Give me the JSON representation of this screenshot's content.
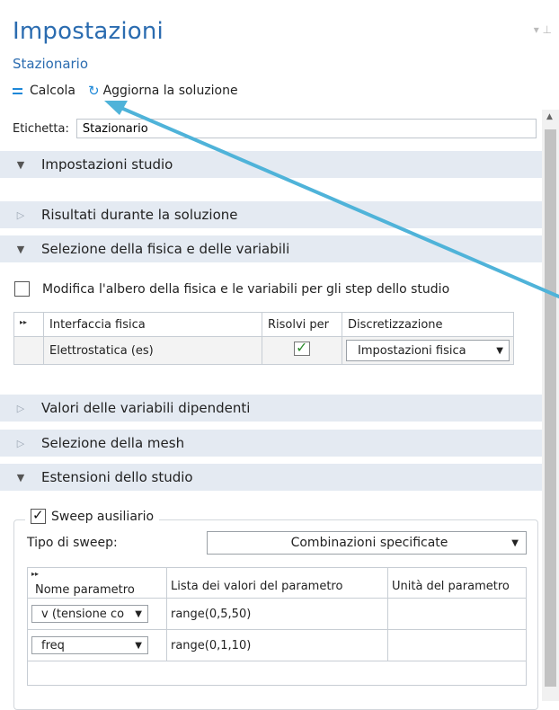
{
  "panel": {
    "title": "Impostazioni",
    "subtitle": "Stazionario"
  },
  "toolbar": {
    "compute_label": "Calcola",
    "update_label": "Aggiorna la soluzione"
  },
  "label_field": {
    "label": "Etichetta:",
    "value": "Stazionario"
  },
  "sections": {
    "study_settings": "Impostazioni studio",
    "results_while_solving": "Risultati durante la soluzione",
    "physics_selection": "Selezione della fisica e delle variabili",
    "dependent_values": "Valori delle variabili dipendenti",
    "mesh_selection": "Selezione della mesh",
    "study_extensions": "Estensioni dello studio"
  },
  "physics": {
    "modify_tree_label": "Modifica l'albero della fisica e le variabili per gli step dello studio",
    "headers": {
      "interface": "Interfaccia fisica",
      "solve_for": "Risolvi per",
      "discretization": "Discretizzazione"
    },
    "row": {
      "interface": "Elettrostatica (es)",
      "discretization": "Impostazioni fisica"
    }
  },
  "sweep": {
    "auxiliary_label": "Sweep ausiliario",
    "type_label": "Tipo di sweep:",
    "type_value": "Combinazioni specificate",
    "headers": {
      "name": "Nome parametro",
      "values": "Lista dei valori del parametro",
      "unit": "Unità del parametro"
    },
    "rows": [
      {
        "name": "v (tensione co",
        "values": "range(0,5,50)",
        "unit": ""
      },
      {
        "name": "freq",
        "values": "range(0,1,10)",
        "unit": ""
      }
    ]
  },
  "icons": {
    "compute": "compute-icon",
    "refresh": "refresh-icon",
    "pin": "pin-icon"
  },
  "colors": {
    "accent": "#2b6cb0",
    "section_bg": "#e4eaf2",
    "annotation_arrow": "#4fb3d9"
  }
}
